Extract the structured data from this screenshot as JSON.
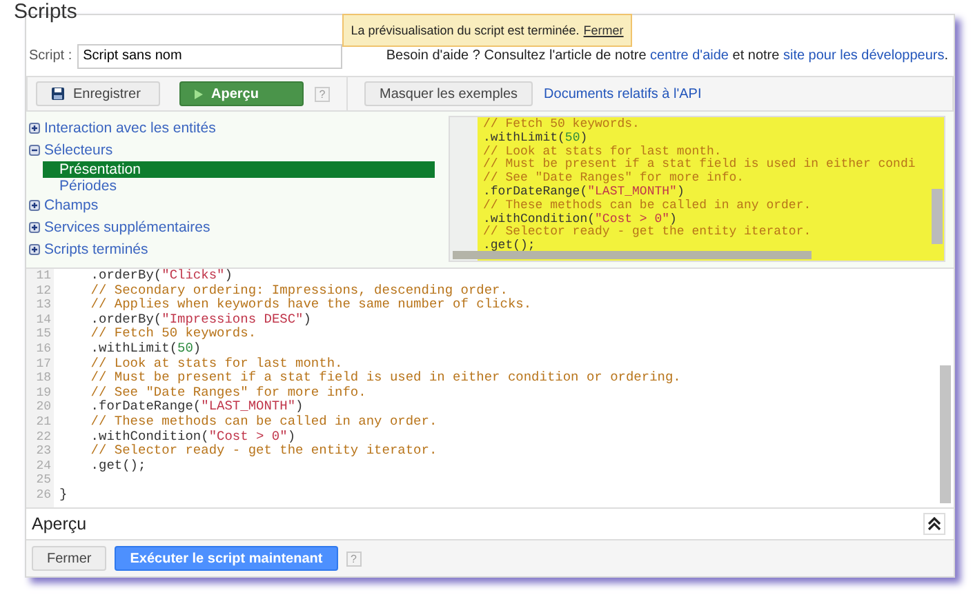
{
  "title": "Scripts",
  "toast": {
    "message": "La prévisualisation du script est terminée.",
    "link": "Fermer"
  },
  "script_field": {
    "label": "Script :",
    "value": "Script sans nom"
  },
  "help": [
    {
      "kind": "text",
      "text": "Besoin d'aide ? Consultez l'article de notre "
    },
    {
      "kind": "link",
      "text": "centre d'aide"
    },
    {
      "kind": "text",
      "text": " et notre "
    },
    {
      "kind": "link",
      "text": "site pour les développeurs"
    },
    {
      "kind": "text",
      "text": "."
    }
  ],
  "toolbar": [
    {
      "kind": "save",
      "label": "Enregistrer"
    },
    {
      "kind": "run",
      "label": "Aperçu"
    },
    {
      "kind": "help",
      "label": "?"
    },
    {
      "kind": "plain",
      "label": "Masquer les exemples"
    },
    {
      "kind": "link",
      "label": "Documents relatifs à l'API"
    }
  ],
  "tree": [
    {
      "label": "Interaction avec les entités",
      "expanded": false
    },
    {
      "label": "Sélecteurs",
      "expanded": true,
      "children": [
        {
          "label": "Présentation",
          "selected": true
        },
        {
          "label": "Périodes",
          "selected": false
        }
      ]
    },
    {
      "label": "Champs",
      "expanded": false
    },
    {
      "label": "Services supplémentaires",
      "expanded": false
    },
    {
      "label": "Scripts terminés",
      "expanded": false
    }
  ],
  "example_code": [
    {
      "parts": [
        {
          "kind": "comment",
          "text": "// Fetch 50 keywords."
        }
      ]
    },
    {
      "parts": [
        {
          "kind": "plain",
          "text": ".withLimit("
        },
        {
          "kind": "number",
          "text": "50"
        },
        {
          "kind": "plain",
          "text": ")"
        }
      ]
    },
    {
      "parts": [
        {
          "kind": "comment",
          "text": "// Look at stats for last month."
        }
      ]
    },
    {
      "parts": [
        {
          "kind": "comment",
          "text": "// Must be present if a stat field is used in either condi"
        }
      ]
    },
    {
      "parts": [
        {
          "kind": "comment",
          "text": "// See \"Date Ranges\" for more info."
        }
      ]
    },
    {
      "parts": [
        {
          "kind": "plain",
          "text": ".forDateRange("
        },
        {
          "kind": "string",
          "text": "\"LAST_MONTH\""
        },
        {
          "kind": "plain",
          "text": ")"
        }
      ]
    },
    {
      "parts": [
        {
          "kind": "comment",
          "text": "// These methods can be called in any order."
        }
      ]
    },
    {
      "parts": [
        {
          "kind": "plain",
          "text": ".withCondition("
        },
        {
          "kind": "string",
          "text": "\"Cost > 0\""
        },
        {
          "kind": "plain",
          "text": ")"
        }
      ]
    },
    {
      "parts": [
        {
          "kind": "comment",
          "text": "// Selector ready - get the entity iterator."
        }
      ]
    },
    {
      "parts": [
        {
          "kind": "plain",
          "text": ".get();"
        }
      ]
    }
  ],
  "editor": [
    {
      "number": "11",
      "parts": [
        {
          "kind": "plain",
          "text": "    .orderBy("
        },
        {
          "kind": "string",
          "text": "\"Clicks\""
        },
        {
          "kind": "plain",
          "text": ")"
        }
      ]
    },
    {
      "number": "12",
      "parts": [
        {
          "kind": "comment",
          "text": "    // Secondary ordering: Impressions, descending order."
        }
      ]
    },
    {
      "number": "13",
      "parts": [
        {
          "kind": "comment",
          "text": "    // Applies when keywords have the same number of clicks."
        }
      ]
    },
    {
      "number": "14",
      "parts": [
        {
          "kind": "plain",
          "text": "    .orderBy("
        },
        {
          "kind": "string",
          "text": "\"Impressions DESC\""
        },
        {
          "kind": "plain",
          "text": ")"
        }
      ]
    },
    {
      "number": "15",
      "parts": [
        {
          "kind": "comment",
          "text": "    // Fetch 50 keywords."
        }
      ]
    },
    {
      "number": "16",
      "parts": [
        {
          "kind": "plain",
          "text": "    .withLimit("
        },
        {
          "kind": "number",
          "text": "50"
        },
        {
          "kind": "plain",
          "text": ")"
        }
      ]
    },
    {
      "number": "17",
      "parts": [
        {
          "kind": "comment",
          "text": "    // Look at stats for last month."
        }
      ]
    },
    {
      "number": "18",
      "parts": [
        {
          "kind": "comment",
          "text": "    // Must be present if a stat field is used in either condition or ordering."
        }
      ]
    },
    {
      "number": "19",
      "parts": [
        {
          "kind": "comment",
          "text": "    // See \"Date Ranges\" for more info."
        }
      ]
    },
    {
      "number": "20",
      "parts": [
        {
          "kind": "plain",
          "text": "    .forDateRange("
        },
        {
          "kind": "string",
          "text": "\"LAST_MONTH\""
        },
        {
          "kind": "plain",
          "text": ")"
        }
      ]
    },
    {
      "number": "21",
      "parts": [
        {
          "kind": "comment",
          "text": "    // These methods can be called in any order."
        }
      ]
    },
    {
      "number": "22",
      "parts": [
        {
          "kind": "plain",
          "text": "    .withCondition("
        },
        {
          "kind": "string",
          "text": "\"Cost > 0\""
        },
        {
          "kind": "plain",
          "text": ")"
        }
      ]
    },
    {
      "number": "23",
      "parts": [
        {
          "kind": "comment",
          "text": "    // Selector ready - get the entity iterator."
        }
      ]
    },
    {
      "number": "24",
      "parts": [
        {
          "kind": "plain",
          "text": "    .get();"
        }
      ]
    },
    {
      "number": "25"
    },
    {
      "number": "26",
      "parts": [
        {
          "kind": "plain",
          "text": "}"
        }
      ]
    }
  ],
  "preview": {
    "title": "Aperçu"
  },
  "footer": [
    {
      "kind": "plain",
      "label": "Fermer"
    },
    {
      "kind": "primary",
      "label": "Exécuter le script maintenant"
    },
    {
      "kind": "help",
      "label": "?"
    }
  ]
}
